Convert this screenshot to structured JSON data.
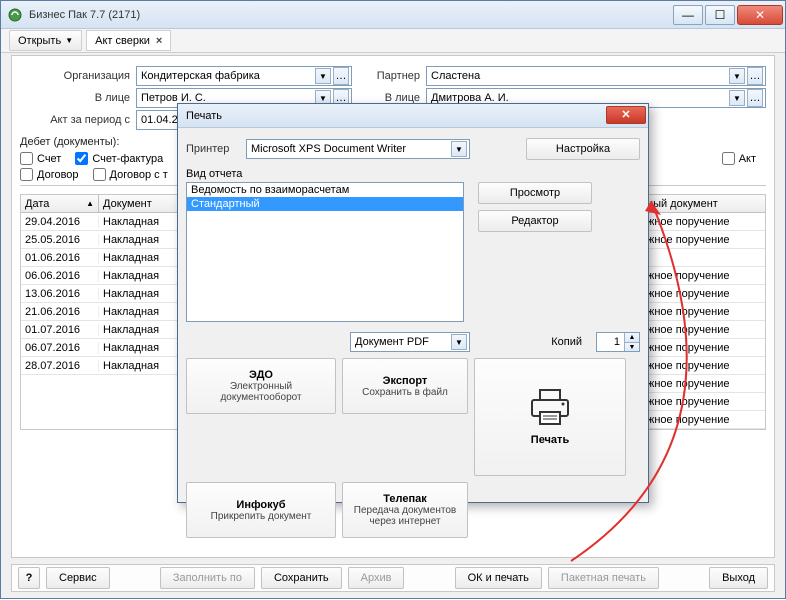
{
  "window": {
    "title": "Бизнес Пак 7.7 (2171)",
    "open_btn": "Открыть",
    "tab1": "Акт сверки"
  },
  "form": {
    "org_label": "Организация",
    "org_value": "Кондитерская фабрика",
    "partner_label": "Партнер",
    "partner_value": "Сластена",
    "face1_label": "В лице",
    "face1_value": "Петров И. С.",
    "face2_label": "В лице",
    "face2_value": "Дмитрова А. И.",
    "period_label": "Акт за период с",
    "period_value": "01.04.2016"
  },
  "debit": {
    "label": "Дебет (документы):",
    "chk_schet": "Счет",
    "chk_sf": "Счет-фактура",
    "chk_dog": "Договор",
    "chk_dogt": "Договор с т",
    "credit_label": "Акт"
  },
  "table": {
    "h1": "Дата",
    "h2": "Документ",
    "h3": "ный документ",
    "rows": [
      {
        "d": "29.04.2016",
        "doc": "Накладная",
        "r": "жное поручение"
      },
      {
        "d": "25.05.2016",
        "doc": "Накладная",
        "r": "жное поручение"
      },
      {
        "d": "01.06.2016",
        "doc": "Накладная",
        "r": ""
      },
      {
        "d": "06.06.2016",
        "doc": "Накладная",
        "r": "жное поручение"
      },
      {
        "d": "13.06.2016",
        "doc": "Накладная",
        "r": "жное поручение"
      },
      {
        "d": "21.06.2016",
        "doc": "Накладная",
        "r": "жное поручение"
      },
      {
        "d": "01.07.2016",
        "doc": "Накладная",
        "r": "жное поручение"
      },
      {
        "d": "06.07.2016",
        "doc": "Накладная",
        "r": "жное поручение"
      },
      {
        "d": "28.07.2016",
        "doc": "Накладная",
        "r": "жное поручение"
      }
    ],
    "extra": [
      "жное поручение",
      "жное поручение",
      "жное поручение"
    ]
  },
  "footer": {
    "service": "Сервис",
    "fill": "Заполнить по",
    "save": "Сохранить",
    "arch": "Архив",
    "okprint": "ОК и печать",
    "batch": "Пакетная печать",
    "exit": "Выход"
  },
  "dialog": {
    "title": "Печать",
    "printer_label": "Принтер",
    "printer_value": "Microsoft XPS Document Writer",
    "setup": "Настройка",
    "report_label": "Вид отчета",
    "li1": "Ведомость по взаиморасчетам",
    "li2": "Стандартный",
    "preview": "Просмотр",
    "editor": "Редактор",
    "docpdf": "Документ PDF",
    "copies_label": "Копий",
    "copies_value": "1",
    "edo_t": "ЭДО",
    "edo_s": "Электронный документооборот",
    "export_t": "Экспорт",
    "export_s": "Сохранить в файл",
    "info_t": "Инфокуб",
    "info_s": "Прикрепить документ",
    "tele_t": "Телепак",
    "tele_s": "Передача документов через интернет",
    "print_t": "Печать"
  }
}
